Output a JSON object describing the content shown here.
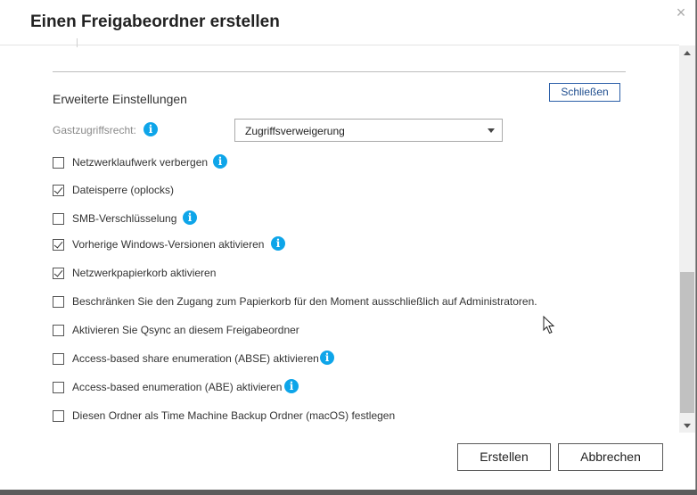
{
  "dialog": {
    "title": "Einen Freigabeordner erstellen",
    "close_symbol": "×"
  },
  "advanced": {
    "section_title": "Erweiterte Einstellungen",
    "collapse_label": "Schließen",
    "guest_access_label": "Gastzugriffsrecht:",
    "guest_access_value": "Zugriffsverweigerung",
    "options": [
      {
        "label": "Netzwerklaufwerk verbergen",
        "checked": false,
        "info": true
      },
      {
        "label": "Dateisperre (oplocks)",
        "checked": true,
        "info": false
      },
      {
        "label": "SMB-Verschlüsselung",
        "checked": false,
        "info": true
      },
      {
        "label": "Vorherige Windows-Versionen aktivieren",
        "checked": true,
        "info": true
      },
      {
        "label": "Netzwerkpapierkorb aktivieren",
        "checked": true,
        "info": false
      },
      {
        "label": "Beschränken Sie den Zugang zum Papierkorb für den Moment ausschließlich auf Administratoren.",
        "checked": false,
        "info": false
      },
      {
        "label": "Aktivieren Sie Qsync an diesem Freigabeordner",
        "checked": false,
        "info": false
      },
      {
        "label": "Access-based share enumeration (ABSE) aktivieren",
        "checked": false,
        "info": true
      },
      {
        "label": "Access-based enumeration (ABE) aktivieren",
        "checked": false,
        "info": true
      },
      {
        "label": "Diesen Ordner als Time Machine Backup Ordner (macOS) festlegen",
        "checked": false,
        "info": false
      }
    ]
  },
  "footer": {
    "create_label": "Erstellen",
    "cancel_label": "Abbrechen"
  },
  "icons": {
    "info": "i",
    "info_color": "#0ea5e9"
  },
  "colors": {
    "accent": "#2b5fa8",
    "info_blue": "#0ea5e9"
  }
}
